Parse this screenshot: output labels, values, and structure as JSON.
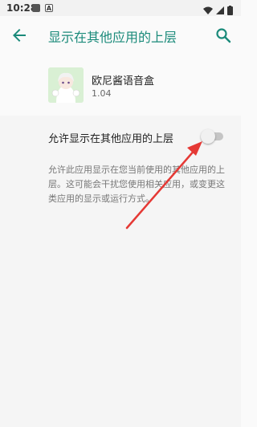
{
  "status_bar": {
    "time": "10:28",
    "notif_letter": "A"
  },
  "toolbar": {
    "title": "显示在其他应用的上层",
    "back_icon": "arrow-back-icon",
    "search_icon": "search-icon"
  },
  "app": {
    "name": "欧尼酱语音盒",
    "version": "1.04"
  },
  "preference": {
    "title": "允许显示在其他应用的上层",
    "enabled": false,
    "summary": "允许此应用显示在您当前使用的其他应用的上层。这可能会干扰您使用相关应用，或变更这类应用的显示或运行方式。"
  },
  "colors": {
    "accent": "#1a8a7a",
    "annotation_arrow": "#e53935"
  }
}
